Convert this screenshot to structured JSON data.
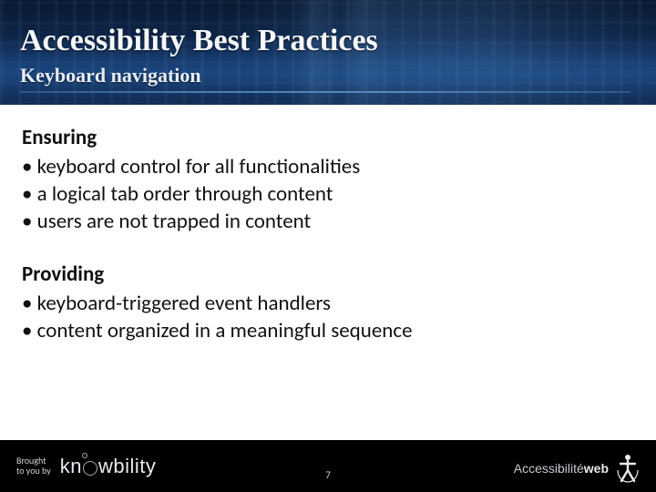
{
  "header": {
    "title": "Accessibility Best Practices",
    "subtitle": "Keyboard navigation"
  },
  "body": {
    "sections": [
      {
        "heading": "Ensuring",
        "bullets": [
          "keyboard control for all functionalities",
          "a logical tab order through content",
          "users are not trapped in content"
        ]
      },
      {
        "heading": "Providing",
        "bullets": [
          "keyboard-triggered event handlers",
          "content organized in a meaningful sequence"
        ]
      }
    ]
  },
  "footer": {
    "brought_line1": "Brought",
    "brought_line2": "to you by",
    "logo1_prefix": "kn",
    "logo1_suffix": "wbility",
    "page_number": "7",
    "logo2_part1": "Accessibilité",
    "logo2_part2": "web"
  }
}
